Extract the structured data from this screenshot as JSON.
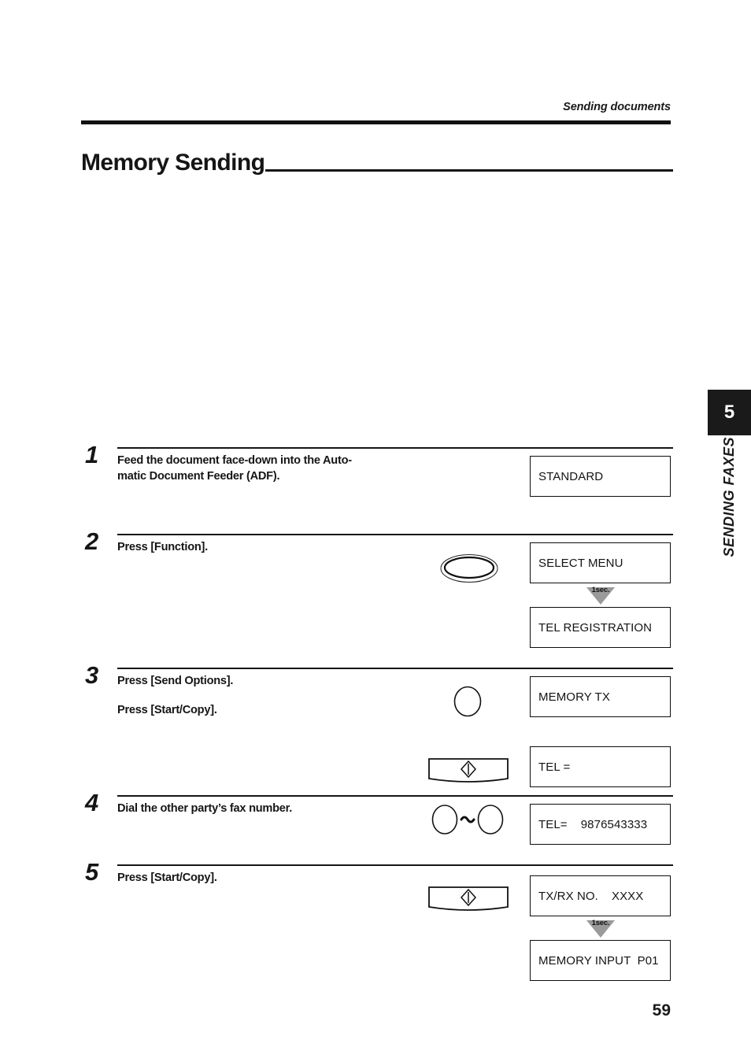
{
  "header": {
    "running_head": "Sending documents",
    "title": "Memory Sending"
  },
  "side_tab": {
    "number": "5",
    "label": "SENDING FAXES"
  },
  "footer": {
    "page_number": "59"
  },
  "labels": {
    "one_sec": "1sec."
  },
  "steps": [
    {
      "number": "1",
      "lines": [
        "Feed the document face-down into the Auto-",
        "matic Document Feeder (ADF)."
      ],
      "displays": [
        "STANDARD"
      ]
    },
    {
      "number": "2",
      "lines": [
        "Press [Function]."
      ],
      "displays": [
        "SELECT MENU",
        "TEL REGISTRATION"
      ],
      "key": "function-oval-key"
    },
    {
      "number": "3",
      "lines": [
        "Press [Send Options].",
        "Press [Start/Copy]."
      ],
      "displays": [
        "MEMORY TX",
        "TEL ="
      ],
      "keys": [
        "send-options-circle-key",
        "start-copy-key"
      ]
    },
    {
      "number": "4",
      "lines": [
        "Dial the other party’s fax number."
      ],
      "displays": [
        "TEL=    9876543333"
      ],
      "key": "numeric-keys-range"
    },
    {
      "number": "5",
      "lines": [
        "Press [Start/Copy]."
      ],
      "displays": [
        "TX/RX NO.    XXXX",
        "MEMORY INPUT  P01"
      ],
      "key": "start-copy-key"
    }
  ]
}
